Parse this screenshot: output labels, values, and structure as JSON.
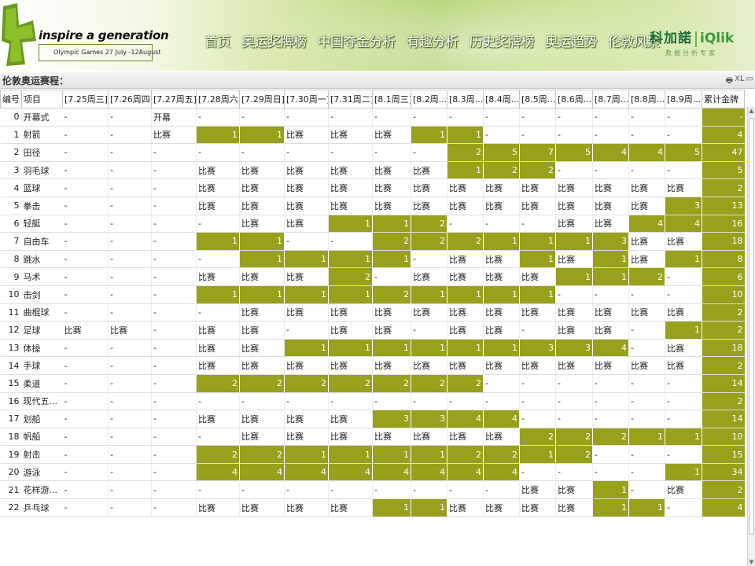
{
  "header": {
    "tagline": "inspire a generation",
    "subtagline": "Olympic Games 27 July -12August",
    "nav": [
      "首页",
      "奥运奖牌榜",
      "中国夺金分析",
      "有趣分析",
      "历史奖牌榜",
      "奥运趋势",
      "伦敦风景"
    ],
    "brand_name": "科加諾",
    "brand_qlik": "iQlik",
    "brand_sub": "数据分析专家"
  },
  "panel": {
    "title": "伦敦奥运赛程：",
    "icons": [
      "print-icon",
      "excel-icon",
      "maximize-icon"
    ],
    "icon_glyphs": [
      "🖶",
      "XL",
      "▭"
    ]
  },
  "table": {
    "columns": [
      "编号",
      "项目",
      "[7.25周三]",
      "[7.26周四]",
      "[7.27周五]",
      "[7.28周六]",
      "[7.29周日]",
      "[7.30周一]",
      "[7.31周二]",
      "[8.1周三]",
      "[8.2周...",
      "[8.3周...",
      "[8.4周...",
      "[8.5周...",
      "[8.6周...",
      "[8.7周...",
      "[8.8周...",
      "[8.9周...",
      "累计金牌"
    ],
    "rows": [
      {
        "id": "0",
        "name": "开幕式",
        "cells": [
          "-",
          "-",
          "开幕",
          "-",
          "-",
          "-",
          "-",
          "-",
          "-",
          "-",
          "-",
          "-",
          "-",
          "-",
          "-",
          "-"
        ],
        "total": "-"
      },
      {
        "id": "1",
        "name": "射箭",
        "cells": [
          "-",
          "-",
          "比赛",
          "1",
          "1",
          "比赛",
          "比赛",
          "比赛",
          "1",
          "1",
          "-",
          "-",
          "-",
          "-",
          "-",
          "-"
        ],
        "total": "4"
      },
      {
        "id": "2",
        "name": "田径",
        "cells": [
          "-",
          "-",
          "-",
          "-",
          "-",
          "-",
          "-",
          "-",
          "-",
          "2",
          "5",
          "7",
          "5",
          "4",
          "4",
          "5"
        ],
        "total": "47"
      },
      {
        "id": "3",
        "name": "羽毛球",
        "cells": [
          "-",
          "-",
          "-",
          "比赛",
          "比赛",
          "比赛",
          "比赛",
          "比赛",
          "比赛",
          "1",
          "2",
          "2",
          "-",
          "-",
          "-",
          "-"
        ],
        "total": "5"
      },
      {
        "id": "4",
        "name": "篮球",
        "cells": [
          "-",
          "-",
          "-",
          "比赛",
          "比赛",
          "比赛",
          "比赛",
          "比赛",
          "比赛",
          "比赛",
          "比赛",
          "比赛",
          "比赛",
          "比赛",
          "比赛",
          "比赛"
        ],
        "total": "2"
      },
      {
        "id": "5",
        "name": "拳击",
        "cells": [
          "-",
          "-",
          "-",
          "比赛",
          "比赛",
          "比赛",
          "比赛",
          "比赛",
          "比赛",
          "比赛",
          "比赛",
          "比赛",
          "比赛",
          "比赛",
          "比赛",
          "3"
        ],
        "total": "13"
      },
      {
        "id": "6",
        "name": "轻艇",
        "cells": [
          "-",
          "-",
          "-",
          "-",
          "比赛",
          "比赛",
          "1",
          "1",
          "2",
          "-",
          "-",
          "-",
          "比赛",
          "比赛",
          "4",
          "4"
        ],
        "total": "16"
      },
      {
        "id": "7",
        "name": "自由车",
        "cells": [
          "-",
          "-",
          "-",
          "1",
          "1",
          "-",
          "-",
          "2",
          "2",
          "2",
          "1",
          "1",
          "1",
          "3",
          "比赛",
          "比赛"
        ],
        "total": "18"
      },
      {
        "id": "8",
        "name": "跳水",
        "cells": [
          "-",
          "-",
          "-",
          "-",
          "1",
          "1",
          "1",
          "1",
          "-",
          "比赛",
          "比赛",
          "1",
          "比赛",
          "1",
          "比赛",
          "1"
        ],
        "total": "8"
      },
      {
        "id": "9",
        "name": "马术",
        "cells": [
          "-",
          "-",
          "-",
          "比赛",
          "比赛",
          "比赛",
          "2",
          "-",
          "比赛",
          "比赛",
          "比赛",
          "比赛",
          "1",
          "1",
          "2",
          "-"
        ],
        "total": "6"
      },
      {
        "id": "10",
        "name": "击剑",
        "cells": [
          "-",
          "-",
          "-",
          "1",
          "1",
          "1",
          "1",
          "2",
          "1",
          "1",
          "1",
          "1",
          "-",
          "-",
          "-",
          "-"
        ],
        "total": "10"
      },
      {
        "id": "11",
        "name": "曲棍球",
        "cells": [
          "-",
          "-",
          "-",
          "-",
          "比赛",
          "比赛",
          "比赛",
          "比赛",
          "比赛",
          "比赛",
          "比赛",
          "比赛",
          "比赛",
          "比赛",
          "比赛",
          "比赛"
        ],
        "total": "2"
      },
      {
        "id": "12",
        "name": "足球",
        "cells": [
          "比赛",
          "比赛",
          "-",
          "比赛",
          "比赛",
          "-",
          "比赛",
          "比赛",
          "-",
          "比赛",
          "比赛",
          "-",
          "比赛",
          "比赛",
          "-",
          "1"
        ],
        "total": "2"
      },
      {
        "id": "13",
        "name": "体操",
        "cells": [
          "-",
          "-",
          "-",
          "比赛",
          "比赛",
          "1",
          "1",
          "1",
          "1",
          "1",
          "1",
          "3",
          "3",
          "4",
          "-",
          "比赛"
        ],
        "total": "18"
      },
      {
        "id": "14",
        "name": "手球",
        "cells": [
          "-",
          "-",
          "-",
          "比赛",
          "比赛",
          "比赛",
          "比赛",
          "比赛",
          "比赛",
          "比赛",
          "比赛",
          "比赛",
          "比赛",
          "比赛",
          "比赛",
          "比赛"
        ],
        "total": "2"
      },
      {
        "id": "15",
        "name": "柔道",
        "cells": [
          "-",
          "-",
          "-",
          "2",
          "2",
          "2",
          "2",
          "2",
          "2",
          "2",
          "-",
          "-",
          "-",
          "-",
          "-",
          "-"
        ],
        "total": "14"
      },
      {
        "id": "16",
        "name": "现代五...",
        "cells": [
          "-",
          "-",
          "-",
          "-",
          "-",
          "-",
          "-",
          "-",
          "-",
          "-",
          "-",
          "-",
          "-",
          "-",
          "-",
          "-"
        ],
        "total": "2"
      },
      {
        "id": "17",
        "name": "划船",
        "cells": [
          "-",
          "-",
          "-",
          "比赛",
          "比赛",
          "比赛",
          "比赛",
          "3",
          "3",
          "4",
          "4",
          "-",
          "-",
          "-",
          "-",
          "-"
        ],
        "total": "14"
      },
      {
        "id": "18",
        "name": "帆船",
        "cells": [
          "-",
          "-",
          "-",
          "-",
          "比赛",
          "比赛",
          "比赛",
          "比赛",
          "比赛",
          "比赛",
          "比赛",
          "2",
          "2",
          "2",
          "1",
          "1"
        ],
        "total": "10"
      },
      {
        "id": "19",
        "name": "射击",
        "cells": [
          "-",
          "-",
          "-",
          "2",
          "2",
          "1",
          "1",
          "1",
          "1",
          "2",
          "2",
          "1",
          "2",
          "-",
          "-",
          "-"
        ],
        "total": "15"
      },
      {
        "id": "20",
        "name": "游泳",
        "cells": [
          "-",
          "-",
          "-",
          "4",
          "4",
          "4",
          "4",
          "4",
          "4",
          "4",
          "4",
          "-",
          "-",
          "-",
          "-",
          "1"
        ],
        "total": "34"
      },
      {
        "id": "21",
        "name": "花样游...",
        "cells": [
          "-",
          "-",
          "-",
          "-",
          "-",
          "-",
          "-",
          "-",
          "-",
          "-",
          "-",
          "比赛",
          "比赛",
          "1",
          "-",
          "比赛"
        ],
        "total": "2"
      },
      {
        "id": "22",
        "name": "乒乓球",
        "cells": [
          "-",
          "-",
          "-",
          "比赛",
          "比赛",
          "比赛",
          "比赛",
          "1",
          "1",
          "比赛",
          "比赛",
          "比赛",
          "比赛",
          "1",
          "1",
          "-"
        ],
        "total": "4"
      }
    ]
  },
  "colors": {
    "gold_cell": "#98a01c",
    "header_green": "#aacd62",
    "brand_green": "#1d6e3a"
  }
}
